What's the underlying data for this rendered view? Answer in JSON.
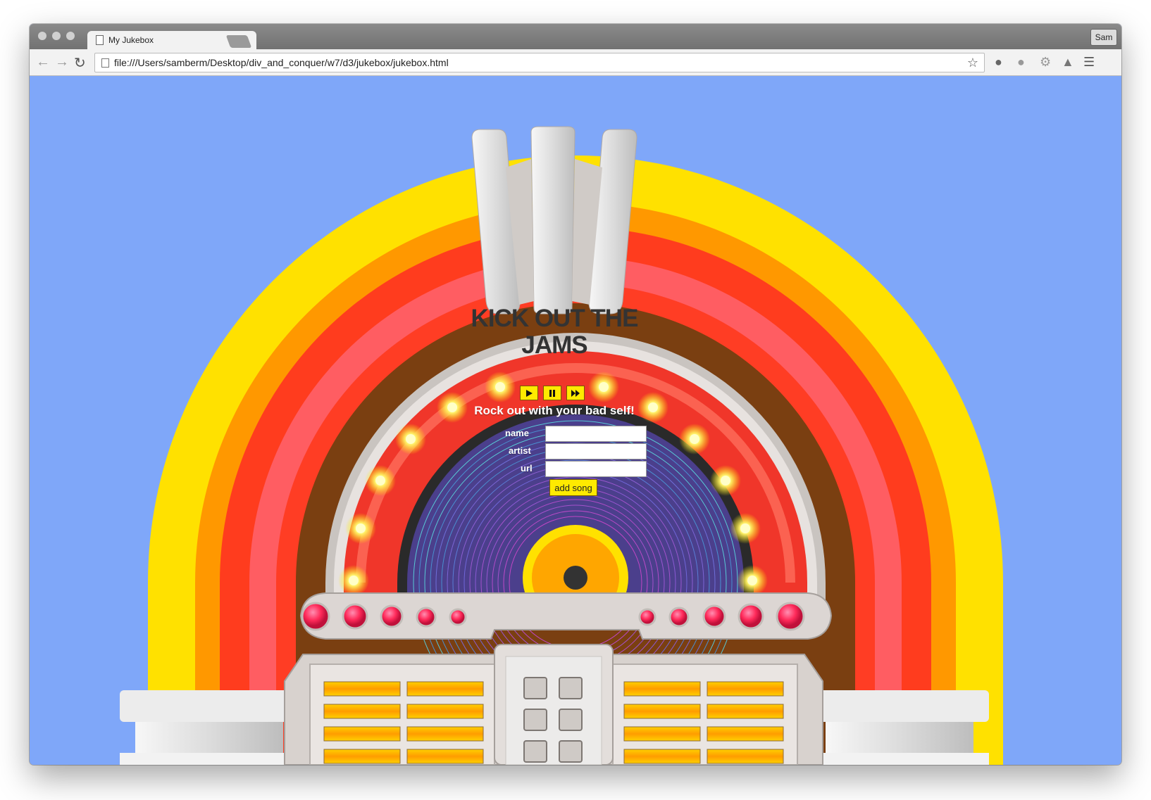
{
  "browser": {
    "tab_title": "My Jukebox",
    "tab_close": "×",
    "url": "file:///Users/samberm/Desktop/div_and_conquer/w7/d3/jukebox/jukebox.html",
    "profile_name": "Sam",
    "icons": [
      "back-icon",
      "forward-icon",
      "reload-icon",
      "page-icon",
      "star-icon",
      "ghost-extension-icon",
      "extension-icon",
      "gear-extension-icon",
      "drive-extension-icon",
      "menu-icon"
    ]
  },
  "jukebox": {
    "title": "KICK OUT THE JAMS",
    "controls": [
      "play-icon",
      "pause-icon",
      "fast-forward-icon"
    ],
    "tagline": "Rock out with your bad self!",
    "form": {
      "name_label": "name",
      "artist_label": "artist",
      "url_label": "url",
      "name_value": "",
      "artist_value": "",
      "url_value": "",
      "submit_label": "add song"
    }
  },
  "colors": {
    "background": "#7fa7f9",
    "arch_yellow": "#ffe100",
    "arch_red": "#ff3c1e",
    "wood": "#7a3f11",
    "button_yellow": "#ffea00",
    "heading": "#333333"
  }
}
